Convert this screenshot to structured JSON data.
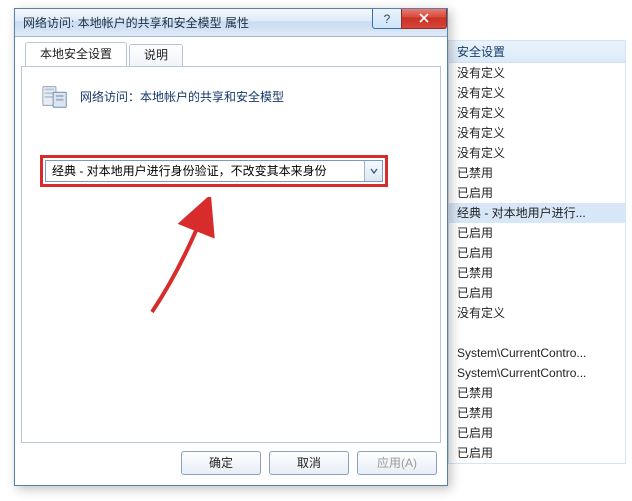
{
  "dialog": {
    "title": "网络访问: 本地帐户的共享和安全模型 属性",
    "tabs": {
      "tab1": "本地安全设置",
      "tab2": "说明"
    },
    "policy_title": "网络访问：本地帐户的共享和安全模型",
    "dropdown_value": "经典 - 对本地用户进行身份验证，不改变其本来身份",
    "buttons": {
      "ok": "确定",
      "cancel": "取消",
      "apply": "应用(A)"
    }
  },
  "bg": {
    "header": "安全设置",
    "items": [
      "没有定义",
      "没有定义",
      "没有定义",
      "没有定义",
      "没有定义",
      "已禁用",
      "已启用",
      "经典 - 对本地用户进行...",
      "已启用",
      "已启用",
      "已禁用",
      "已启用",
      "没有定义",
      "",
      "System\\CurrentContro...",
      "System\\CurrentContro...",
      "已禁用",
      "已禁用",
      "已启用",
      "已启用"
    ],
    "selected_index": 7
  }
}
